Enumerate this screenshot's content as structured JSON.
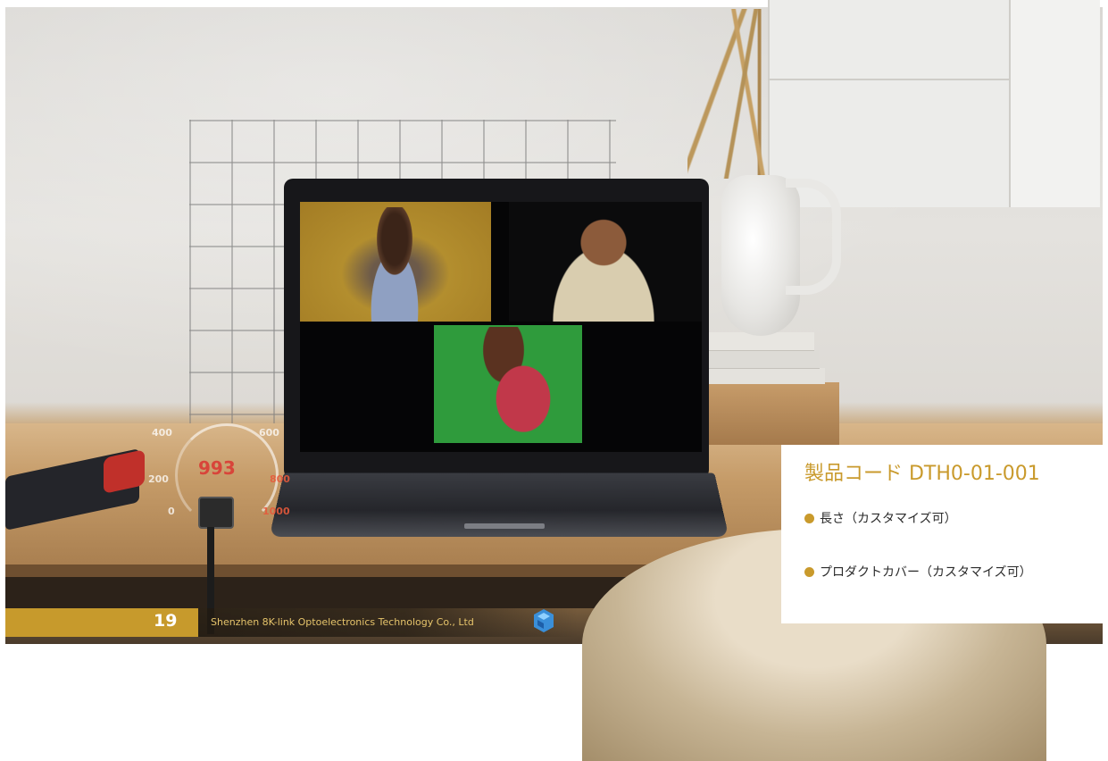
{
  "hud": {
    "value": "993",
    "ticks": [
      "400",
      "600",
      "200",
      "800",
      "0",
      "1000"
    ]
  },
  "footer": {
    "page_number": "19",
    "company": "Shenzhen 8K-link Optoelectronics Technology Co., Ltd"
  },
  "product_card": {
    "title": "製品コード DTH0-01-001",
    "items": [
      "長さ（カスタマイズ可）",
      "プロダクトカバー（カスタマイズ可）"
    ]
  },
  "colors": {
    "accent_gold": "#c99a2c",
    "hud_red": "#d8453a"
  }
}
